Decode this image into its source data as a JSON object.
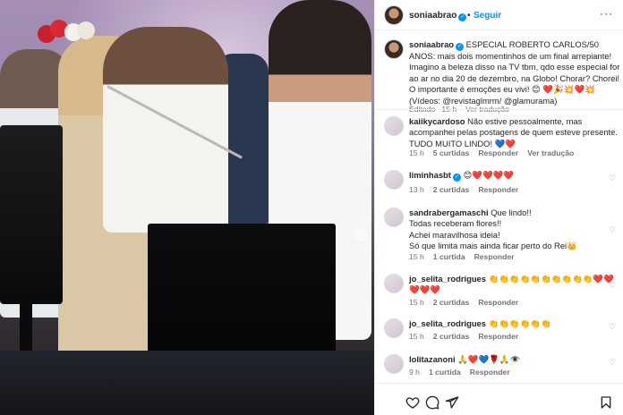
{
  "header": {
    "username": "soniaabrao",
    "dot": "•",
    "follow_label": "Seguir",
    "more": "···"
  },
  "caption": {
    "username": "soniaabrao",
    "text": "ESPECIAL ROBERTO CARLOS/50 ANOS: mais dois momentinhos de um final arrepiante! Imagino a beleza disso na TV tbm, qdo esse especial for ao ar no dia 20 de dezembro, na Globo! Chorar? Chorei! O importante é emoções eu vivi! 😊 ❤️🎉💥❤️💥 (Vídeos: @revistaglmrm/ @glamurama)",
    "edited": "Editado",
    "time": "· 15 h",
    "translation": "Ver tradução"
  },
  "comments": [
    {
      "username": "kaiikycardoso",
      "text": "Não estive pessoalmente, mas acompanhei pelas postagens de quem esteve presente. TUDO MUITO LINDO! 💙❤️",
      "time": "15 h",
      "likes": "5 curtidas",
      "reply": "Responder",
      "translation": "Ver tradução"
    },
    {
      "username": "liminhasbt",
      "text": "😊❤️❤️❤️❤️",
      "time": "13 h",
      "likes": "2 curtidas",
      "reply": "Responder"
    },
    {
      "username": "sandrabergamaschi",
      "text_lines": [
        "Que lindo!!",
        "Todas receberam flores!!",
        "Achei maravilhosa ideia!",
        "Só que limita mais ainda ficar perto do Rei👑"
      ],
      "time": "15 h",
      "likes": "1 curtida",
      "reply": "Responder"
    },
    {
      "username": "jo_selita_rodrigues",
      "text": "👏👏👏👏👏👏👏👏👏👏❤️❤️❤️❤️❤️",
      "time": "15 h",
      "likes": "2 curtidas",
      "reply": "Responder"
    },
    {
      "username": "jo_selita_rodrigues",
      "text": "👏👏👏👏👏👏",
      "time": "15 h",
      "likes": "2 curtidas",
      "reply": "Responder"
    },
    {
      "username": "lolitazanoni",
      "text": "🙏❤️💙🌹🙏👁️",
      "time": "9 h",
      "likes": "1 curtida",
      "reply": "Responder"
    }
  ],
  "footer": {
    "icons": [
      "heart-icon",
      "comment-icon",
      "share-icon",
      "bookmark-icon"
    ]
  },
  "colors": {
    "accent": "#0095f6",
    "like": "#ed4956",
    "muted": "#737373"
  }
}
